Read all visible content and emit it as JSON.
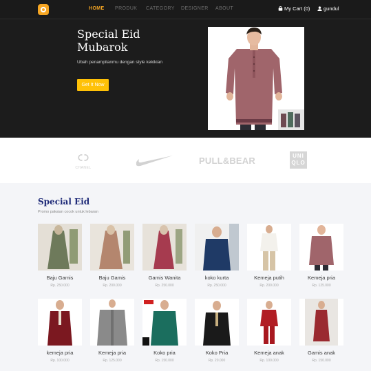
{
  "nav": {
    "links": [
      "HOME",
      "PRODUK",
      "CATEGORY",
      "DESIGNER",
      "ABOUT"
    ],
    "cart_label": "My Cart",
    "cart_count": "(0)",
    "user_label": "gundul",
    "accent_color": "#f6a623"
  },
  "hero": {
    "title": "Special Eid Mubarok",
    "subtitle": "Ubah penampilanmu dengan style kekikian",
    "button_label": "Get It Now",
    "button_color": "#ffc107"
  },
  "brands": [
    "CHANEL",
    "nike-swoosh-logo",
    "PULL&BEAR",
    "UNI QLO"
  ],
  "section": {
    "title": "Special Eid",
    "subtitle": "Promo pakaian cocok untuk lebaran",
    "title_color": "#1e2a78"
  },
  "products": [
    {
      "name": "Baju Gamis",
      "price": "Rp. 250.000"
    },
    {
      "name": "Baju Gamis",
      "price": "Rp. 200.000"
    },
    {
      "name": "Gamis Wanita",
      "price": "Rp. 250.000"
    },
    {
      "name": "koko kurta",
      "price": "Rp. 250.000"
    },
    {
      "name": "Kemeja putih",
      "price": "Rp. 200.000"
    },
    {
      "name": "Kemeja pria",
      "price": "Rp. 125.000"
    },
    {
      "name": "kemeja pria",
      "price": "Rp. 100.000"
    },
    {
      "name": "Kemeja pria",
      "price": "Rp. 125.000"
    },
    {
      "name": "Koko pria",
      "price": "Rp. 150.000"
    },
    {
      "name": "Koko Pria",
      "price": "Rp. 20.000"
    },
    {
      "name": "Kemeja anak",
      "price": "Rp. 100.000"
    },
    {
      "name": "Gamis anak",
      "price": "Rp. 150.000"
    }
  ]
}
